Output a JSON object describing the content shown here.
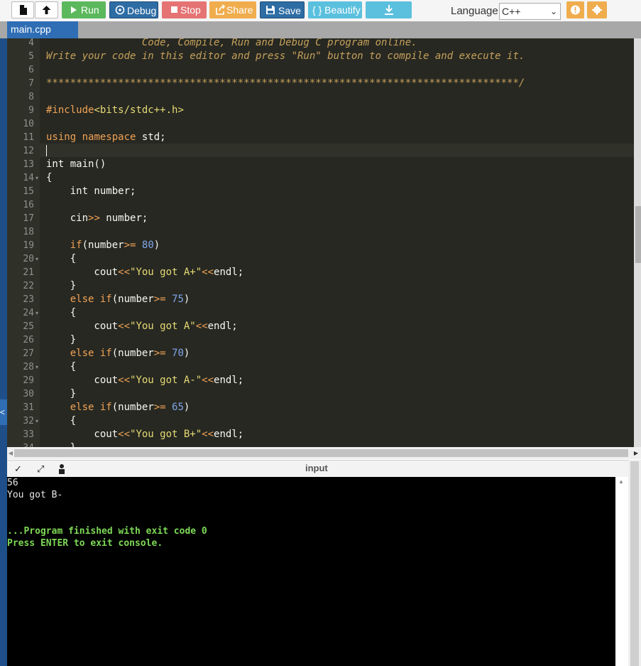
{
  "toolbar": {
    "run": "Run",
    "debug": "Debug",
    "stop": "Stop",
    "share": "Share",
    "save": "Save",
    "beautify": "{ } Beautify",
    "language_label": "Language",
    "language_value": "C++"
  },
  "colors": {
    "run_btn": "#5cb85c",
    "debug_btn": "#2e6da4",
    "stop_btn": "#e57373",
    "share_btn": "#f0ad4e",
    "save_btn": "#2e6da4",
    "beautify_btn": "#5bc0de",
    "download_btn": "#5bc0de",
    "info_btn": "#f0ad4e",
    "settings_btn": "#f0ad4e",
    "editor_bg": "#272822",
    "tab_active": "#2f6eb5"
  },
  "icons": {
    "new_file": "file-icon",
    "upload": "upload-icon",
    "run": "play-icon",
    "debug": "bug-icon",
    "stop": "stop-icon",
    "share": "share-icon",
    "save": "floppy-icon",
    "download": "download-icon",
    "info": "info-icon",
    "settings": "gear-icon"
  },
  "tabs": [
    "main.cpp"
  ],
  "editor": {
    "lines": [
      {
        "n": "4",
        "text": "                Code, Compile, Run and Debug C program online."
      },
      {
        "n": "5",
        "text": "Write your code in this editor and press \"Run\" button to compile and execute it."
      },
      {
        "n": "6",
        "text": ""
      },
      {
        "n": "7",
        "text": "*******************************************************************************/"
      },
      {
        "n": "8",
        "text": ""
      },
      {
        "n": "9",
        "text": "#include<bits/stdc++.h>"
      },
      {
        "n": "10",
        "text": ""
      },
      {
        "n": "11",
        "text": "using namespace std;"
      },
      {
        "n": "12",
        "text": ""
      },
      {
        "n": "13",
        "text": "int main()"
      },
      {
        "n": "14",
        "text": "{"
      },
      {
        "n": "15",
        "text": "    int number;"
      },
      {
        "n": "16",
        "text": ""
      },
      {
        "n": "17",
        "text": "    cin>> number;"
      },
      {
        "n": "18",
        "text": ""
      },
      {
        "n": "19",
        "text": "    if(number>= 80)"
      },
      {
        "n": "20",
        "text": "    {"
      },
      {
        "n": "21",
        "text": "        cout<<\"You got A+\"<<endl;"
      },
      {
        "n": "22",
        "text": "    }"
      },
      {
        "n": "23",
        "text": "    else if(number>= 75)"
      },
      {
        "n": "24",
        "text": "    {"
      },
      {
        "n": "25",
        "text": "        cout<<\"You got A\"<<endl;"
      },
      {
        "n": "26",
        "text": "    }"
      },
      {
        "n": "27",
        "text": "    else if(number>= 70)"
      },
      {
        "n": "28",
        "text": "    {"
      },
      {
        "n": "29",
        "text": "        cout<<\"You got A-\"<<endl;"
      },
      {
        "n": "30",
        "text": "    }"
      },
      {
        "n": "31",
        "text": "    else if(number>= 65)"
      },
      {
        "n": "32",
        "text": "    {"
      },
      {
        "n": "33",
        "text": "        cout<<\"You got B+\"<<endl;"
      },
      {
        "n": "34",
        "text": "    }"
      }
    ],
    "fold_lines": [
      "14",
      "20",
      "24",
      "28",
      "32"
    ]
  },
  "console": {
    "title": "input",
    "lines": [
      {
        "text": "56",
        "style": "white"
      },
      {
        "text": "You got B-",
        "style": "white"
      },
      {
        "text": "",
        "style": "white"
      },
      {
        "text": "",
        "style": "white"
      },
      {
        "text": "...Program finished with exit code 0",
        "style": "green"
      },
      {
        "text": "Press ENTER to exit console.",
        "style": "green"
      }
    ]
  }
}
